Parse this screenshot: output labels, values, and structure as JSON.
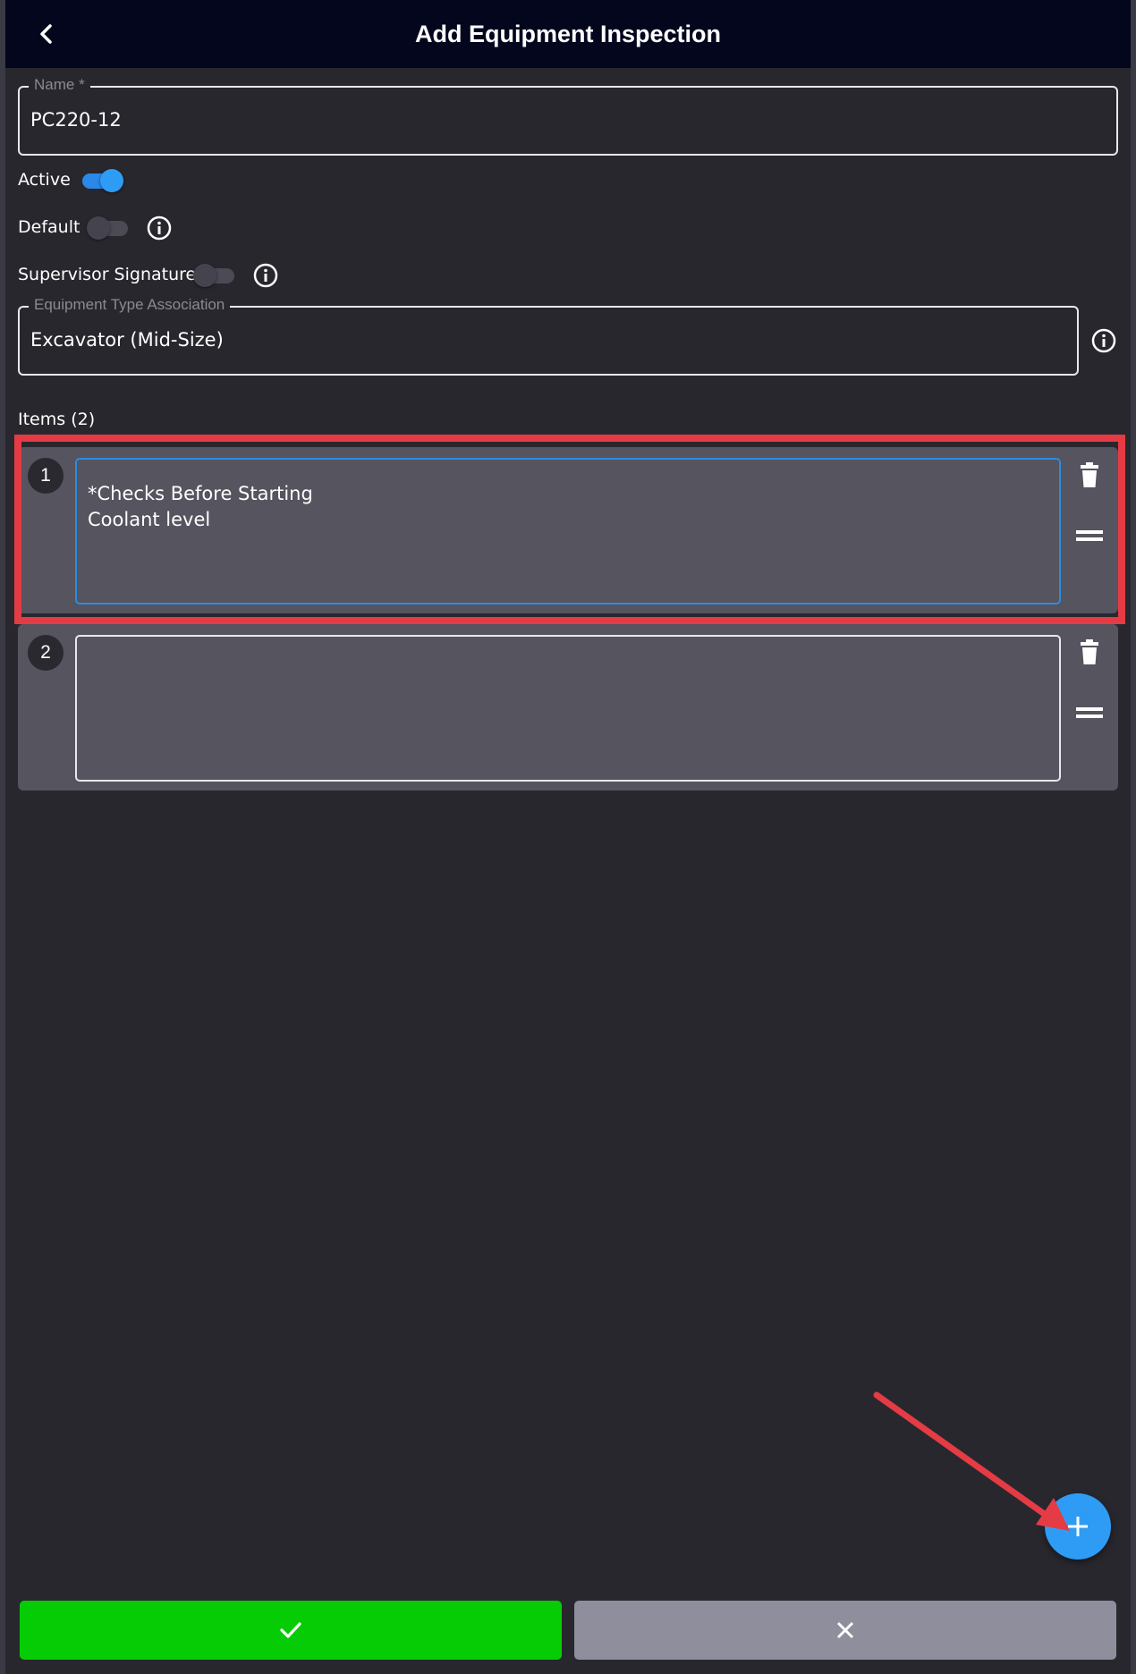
{
  "header": {
    "title": "Add Equipment Inspection",
    "back_icon": "chevron-left-icon"
  },
  "form": {
    "name": {
      "label": "Name *",
      "value": "PC220-12"
    },
    "active": {
      "label": "Active",
      "on": true
    },
    "default": {
      "label": "Default",
      "on": false
    },
    "supervisor_signature": {
      "label": "Supervisor Signature",
      "on": false
    },
    "equipment_type": {
      "label": "Equipment Type Association",
      "value": "Excavator (Mid-Size)"
    }
  },
  "items": {
    "header": "Items (2)",
    "list": [
      {
        "number": "1",
        "text": "*Checks Before Starting\nCoolant level"
      },
      {
        "number": "2",
        "text": ""
      }
    ]
  },
  "colors": {
    "accent": "#2e9cf5",
    "confirm": "#06cc06",
    "cancel": "#8e8e9c",
    "highlight": "#e53b45"
  },
  "actions": {
    "fab_icon": "plus-icon",
    "confirm_icon": "check-icon",
    "cancel_icon": "close-icon"
  }
}
